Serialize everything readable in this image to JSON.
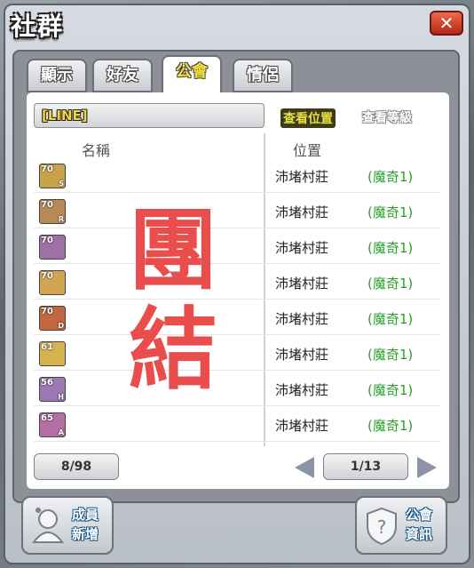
{
  "window": {
    "title": "社群",
    "close_label": "✕"
  },
  "tabs": [
    {
      "label": "顯示",
      "active": false
    },
    {
      "label": "好友",
      "active": false
    },
    {
      "label": "公會",
      "active": true
    },
    {
      "label": "情侶",
      "active": false
    }
  ],
  "guild_name": "[LINE]",
  "view_position_label": "查看位置",
  "view_level_label": "查看等級",
  "columns": {
    "name": "名稱",
    "location": "位置"
  },
  "members": [
    {
      "level": "70",
      "class_letter": "S",
      "location": "沛堵村莊",
      "channel": "(魔奇1)",
      "avatar_color": "#caa24a"
    },
    {
      "level": "70",
      "class_letter": "R",
      "location": "沛堵村莊",
      "channel": "(魔奇1)",
      "avatar_color": "#b98a57"
    },
    {
      "level": "70",
      "class_letter": "",
      "location": "沛堵村莊",
      "channel": "(魔奇1)",
      "avatar_color": "#a06fa8"
    },
    {
      "level": "70",
      "class_letter": "",
      "location": "沛堵村莊",
      "channel": "(魔奇1)",
      "avatar_color": "#d2a552"
    },
    {
      "level": "70",
      "class_letter": "D",
      "location": "沛堵村莊",
      "channel": "(魔奇1)",
      "avatar_color": "#c4673e"
    },
    {
      "level": "61",
      "class_letter": "",
      "location": "沛堵村莊",
      "channel": "(魔奇1)",
      "avatar_color": "#d8b24e"
    },
    {
      "level": "56",
      "class_letter": "H",
      "location": "沛堵村莊",
      "channel": "(魔奇1)",
      "avatar_color": "#9e78b6"
    },
    {
      "level": "65",
      "class_letter": "A",
      "location": "沛堵村莊",
      "channel": "(魔奇1)",
      "avatar_color": "#b56fa3"
    }
  ],
  "stamp_text": [
    "團",
    "結"
  ],
  "member_count": "8/98",
  "pagination": {
    "page": "1/13"
  },
  "buttons": {
    "add_member": [
      "成員",
      "新增"
    ],
    "guild_info": [
      "公會",
      "資訊"
    ]
  },
  "colors": {
    "stamp": "#e8403e",
    "channel": "#2aa02a",
    "guild_name": "#f2d53a",
    "close": "#c9352a"
  }
}
